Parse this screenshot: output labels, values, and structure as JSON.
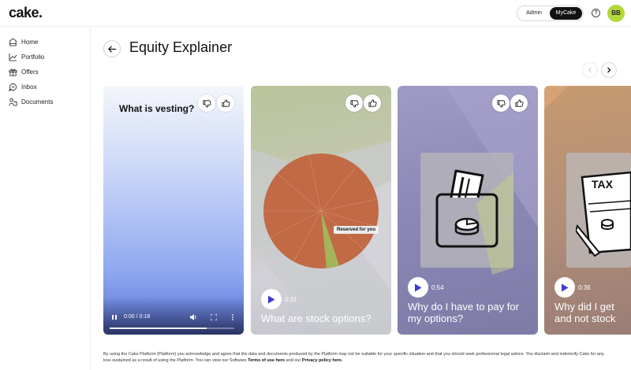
{
  "app": {
    "logo": "cake."
  },
  "header": {
    "toggle": {
      "admin": "Admin",
      "mycake": "MyCake"
    },
    "help": "?",
    "avatar": "BB"
  },
  "sidebar": {
    "items": [
      {
        "label": "Home",
        "icon": "home-icon"
      },
      {
        "label": "Portfolio",
        "icon": "chart-icon"
      },
      {
        "label": "Offers",
        "icon": "gift-icon"
      },
      {
        "label": "Inbox",
        "icon": "chat-icon"
      },
      {
        "label": "Documents",
        "icon": "documents-icon"
      }
    ]
  },
  "page": {
    "title": "Equity Explainer"
  },
  "cards": [
    {
      "heading": "What is vesting?",
      "time": "0:00 / 0:18",
      "progress": 0.78
    },
    {
      "title": "What are stock options?",
      "duration": "0:31",
      "tag": "Reserved for you"
    },
    {
      "title_line1": "Why do I have to pay for",
      "title_line2": "my options?",
      "duration": "0:54"
    },
    {
      "title_line1": "Why did I get",
      "title_line2": "and not stock",
      "duration": "0:36",
      "tax": "TAX"
    }
  ],
  "footer": {
    "text1": "By using the Cake Platform (Platform) you acknowledge and agree that the data and documents produced by the Platform may not be suitable for your specific situation and that you should seek professional legal advice. You disclaim and indemnify Cake for any loss sustained as a result of using the Platform. You can view our Software ",
    "terms": "Terms of use here",
    "and": " and our ",
    "privacy": "Privacy policy here."
  },
  "colors": {
    "accent": "#111111",
    "avatar": "#b4d83a",
    "play": "#3b3bd6"
  }
}
